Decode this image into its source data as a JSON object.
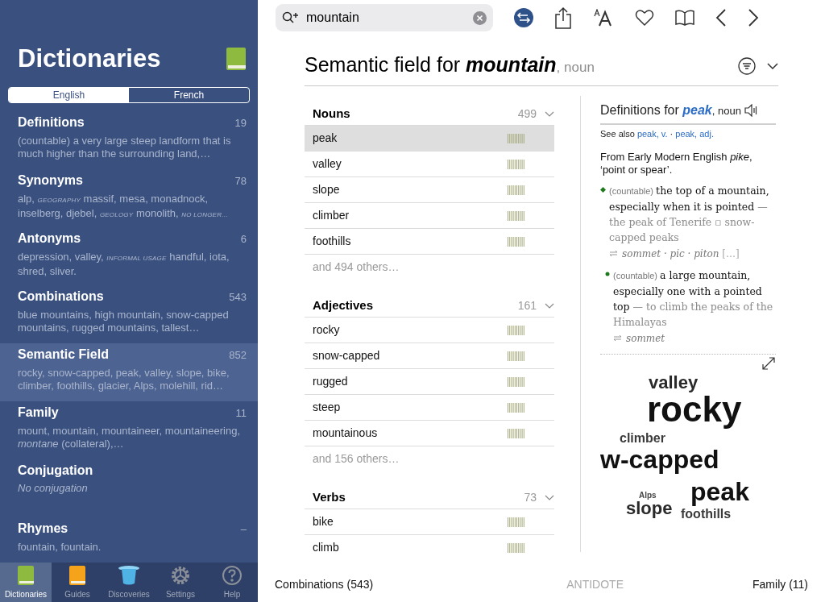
{
  "sidebar": {
    "title": "Dictionaries",
    "segments": [
      {
        "label": "English",
        "selected": true
      },
      {
        "label": "French",
        "selected": false
      }
    ],
    "items": [
      {
        "title": "Definitions",
        "count": "19",
        "selected": false,
        "preview": [
          {
            "kind": "plain",
            "text": "(countable) a very large steep landform that is much higher than the surrounding land,…"
          }
        ]
      },
      {
        "title": "Synonyms",
        "count": "78",
        "selected": false,
        "preview": [
          {
            "kind": "plain",
            "text": "alp, "
          },
          {
            "kind": "label",
            "text": "GEOGRAPHY"
          },
          {
            "kind": "plain",
            "text": " massif, mesa, monadnock, inselberg, djebel, "
          },
          {
            "kind": "label",
            "text": "GEOLOGY"
          },
          {
            "kind": "plain",
            "text": " monolith, "
          },
          {
            "kind": "label",
            "text": "NO LONGER…"
          }
        ]
      },
      {
        "title": "Antonyms",
        "count": "6",
        "selected": false,
        "preview": [
          {
            "kind": "plain",
            "text": "depression, valley, "
          },
          {
            "kind": "label",
            "text": "INFORMAL USAGE"
          },
          {
            "kind": "plain",
            "text": " handful, iota, shred, sliver."
          }
        ]
      },
      {
        "title": "Combinations",
        "count": "543",
        "selected": false,
        "preview": [
          {
            "kind": "plain",
            "text": "blue mountains, high mountain, snow-capped mountains, rugged mountains, tallest…"
          }
        ]
      },
      {
        "title": "Semantic Field",
        "count": "852",
        "selected": true,
        "preview": [
          {
            "kind": "plain",
            "text": "rocky, snow-capped, peak, valley, slope, bike, climber, foothills, glacier, Alps, molehill, rid…"
          }
        ]
      },
      {
        "title": "Family",
        "count": "11",
        "selected": false,
        "preview": [
          {
            "kind": "plain",
            "text": "mount, mountain, mountaineer, mountaineering, "
          },
          {
            "kind": "italic",
            "text": "montane"
          },
          {
            "kind": "plain",
            "text": " (collateral),…"
          }
        ]
      },
      {
        "title": "Conjugation",
        "selected": false,
        "preview": [
          {
            "kind": "italic",
            "text": "No conjugation"
          }
        ]
      },
      {
        "title": "Rhymes",
        "count": "–",
        "selected": false,
        "preview": [
          {
            "kind": "plain",
            "text": "fountain, fountain."
          }
        ]
      }
    ],
    "tabs": [
      {
        "label": "Dictionaries",
        "kind": "green-book",
        "selected": true
      },
      {
        "label": "Guides",
        "kind": "orange-book",
        "selected": false
      },
      {
        "label": "Discoveries",
        "kind": "hat",
        "selected": false
      },
      {
        "label": "Settings",
        "kind": "gear",
        "selected": false
      },
      {
        "label": "Help",
        "kind": "help",
        "selected": false
      }
    ]
  },
  "search": {
    "value": "mountain"
  },
  "heading": {
    "prefix": "Semantic field for ",
    "word": "mountain",
    "pos": ", noun"
  },
  "groups": [
    {
      "title": "Nouns",
      "count": "499",
      "words": [
        {
          "text": "peak",
          "selected": true
        },
        {
          "text": "valley",
          "selected": false
        },
        {
          "text": "slope",
          "selected": false
        },
        {
          "text": "climber",
          "selected": false
        },
        {
          "text": "foothills",
          "selected": false
        }
      ],
      "more": "and 494 others…"
    },
    {
      "title": "Adjectives",
      "count": "161",
      "words": [
        {
          "text": "rocky",
          "selected": false
        },
        {
          "text": "snow-capped",
          "selected": false
        },
        {
          "text": "rugged",
          "selected": false
        },
        {
          "text": "steep",
          "selected": false
        },
        {
          "text": "mountainous",
          "selected": false
        }
      ],
      "more": "and 156 others…"
    },
    {
      "title": "Verbs",
      "count": "73",
      "words": [
        {
          "text": "bike",
          "selected": false
        },
        {
          "text": "climb",
          "selected": false
        }
      ]
    }
  ],
  "definitions": {
    "prefix": "Definitions for ",
    "word": "peak",
    "pos": ", noun",
    "see_also_label": "See also ",
    "separator": "·",
    "see_also": [
      "peak, v.",
      "peak, adj."
    ],
    "etymology": "From Early Modern English *pike*, ‘point or spear’.",
    "senses": [
      {
        "kind": "diamond",
        "label": "(countable)",
        "text": "the top of a mountain, especially when it is pointed",
        "example": " — the peak of Tenerife ▫ snow-capped peaks",
        "translations": "sommet · pic · piton",
        "more": " […]"
      },
      {
        "kind": "dot",
        "label": "(countable)",
        "text": "a large mountain, especially one with a pointed top",
        "example": " — to climb the peaks of the Himalayas",
        "translations": "sommet"
      }
    ]
  },
  "cloud": [
    {
      "text": "valley",
      "kind": "medium"
    },
    {
      "text": "rocky",
      "kind": "huge"
    },
    {
      "text": "climber",
      "kind": "small"
    },
    {
      "text": "w-capped",
      "kind": "large"
    },
    {
      "text": "Alps",
      "kind": "tiny"
    },
    {
      "text": "peak",
      "kind": "large"
    },
    {
      "text": "slope",
      "kind": "medium"
    },
    {
      "text": "foothills",
      "kind": "small"
    }
  ],
  "footer": {
    "previous": "Combinations (543)",
    "brand": "ANTIDOTE",
    "next": "Family (11)"
  }
}
